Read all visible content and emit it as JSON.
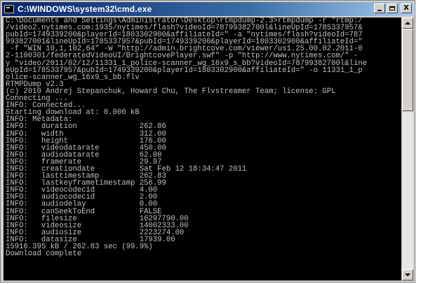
{
  "window": {
    "title": "C:\\WINDOWS\\system32\\cmd.exe",
    "app_icon": "cmd-icon",
    "buttons": {
      "minimize_icon": "minimize-icon",
      "maximize_icon": "maximize-icon",
      "close_label": "X"
    }
  },
  "colors": {
    "title_gradient_start": "#0a246a",
    "title_gradient_end": "#a6caf0",
    "console_background": "#000000",
    "console_text": "#c0c0c0",
    "chrome": "#d4d0c8"
  },
  "console": {
    "lines": [
      "C:\\Documents and Settings\\Administrator\\Desktop\\rtmpdump-2.3>rtmpdump -r \"rtmp:/",
      "/video2.nytimes.com:1935/nytimes/flash?videoId=78799382700l&lineUpId=1785337957&",
      "pubId=1749339200&playerId=1803302900&affiliateId=\" -a \"nytimes/flash?videoId=787",
      "993827001&lineUpId=1785337957&pubId=1749339200&playerId=1803302900&affiliateId=\"",
      " -f \"WIN 10,1,102,64\" -W \"http://admin.brightcove.com/viewer/us1.25.00.02.2011-0",
      "2-1100301/federatedVideoUI/BrightcovePlayer.swf\" -p \"http://www.nytimes.com/\" -",
      "y \"video/2011/02/12/11331_1_police-scanner_wg_16x9_s_bb?videoId=78799382700l&line",
      "eUpId=1785337957&pubId=1749339200&playerId=1803302900&affiliateId=\" -o 11331_1_p",
      "olice-scanner_wg_16x9_s_bb.flv",
      "RTMPDump v2.3",
      "(c) 2010 Andrej Stepanchuk, Howard Chu, The Flvstreamer Team; license: GPL",
      "Connecting ...",
      "INFO: Connected...",
      "Starting download at: 0.000 kB",
      "INFO: Metadata:",
      "INFO:   duration              262.86",
      "INFO:   width                 312.00",
      "INFO:   height                176.00",
      "INFO:   videodatarate         450.00",
      "INFO:   audiodatarate         62.00",
      "INFO:   framerate             29.97",
      "INFO:   creationdate          Sat Feb 12 18:34:47 2011",
      "INFO:   lasttimestamp         262.83",
      "INFO:   lastkeyframetimestamp 256.99",
      "INFO:   videocodecid          4.00",
      "INFO:   audiocodecid          2.00",
      "INFO:   audiodelay            0.00",
      "INFO:   canSeekToEnd          FALSE",
      "INFO:   filesize              16297790.00",
      "INFO:   videosize             14002333.00",
      "INFO:   audiosize             2223274.00",
      "INFO:   datasize              17939.00",
      "15916.395 kB / 262.83 sec (99.9%)",
      "Download complete"
    ]
  },
  "scrollbar": {
    "up_icon": "scroll-up-arrow-icon",
    "down_icon": "scroll-down-arrow-icon",
    "position_fraction": 0.0
  }
}
